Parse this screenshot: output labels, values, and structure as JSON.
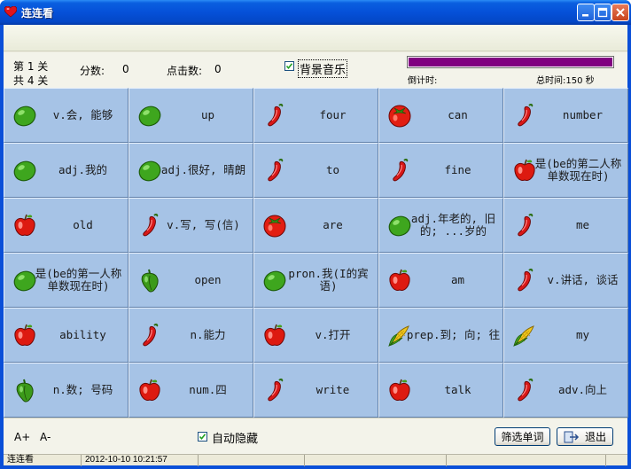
{
  "window": {
    "title": "连连看"
  },
  "info": {
    "level_label": "第 1 关",
    "total_levels_label": "共 4 关",
    "score_label": "分数:",
    "score_value": "0",
    "clicks_label": "点击数:",
    "clicks_value": "0",
    "music_label": "背景音乐",
    "music_checked": true,
    "countdown_label": "倒计时:",
    "total_time_label": "总时间:150 秒",
    "countdown_progress": 1.0
  },
  "board": {
    "rows": [
      [
        {
          "icon": "lime",
          "text": "v.会, 能够"
        },
        {
          "icon": "lime",
          "text": "up"
        },
        {
          "icon": "chili",
          "text": "four"
        },
        {
          "icon": "tomato",
          "text": "can"
        },
        {
          "icon": "chili",
          "text": "number"
        }
      ],
      [
        {
          "icon": "lime",
          "text": "adj.我的"
        },
        {
          "icon": "lime",
          "text": "adj.很好, 晴朗"
        },
        {
          "icon": "chili",
          "text": "to"
        },
        {
          "icon": "chili",
          "text": "fine"
        },
        {
          "icon": "apple",
          "text": "是(be的第二人称单数现在时)"
        }
      ],
      [
        {
          "icon": "apple",
          "text": "old"
        },
        {
          "icon": "chili",
          "text": "v.写, 写(信)"
        },
        {
          "icon": "tomato",
          "text": "are"
        },
        {
          "icon": "lime",
          "text": "adj.年老的, 旧的; ...岁的"
        },
        {
          "icon": "chili",
          "text": "me"
        }
      ],
      [
        {
          "icon": "lime",
          "text": "是(be的第一人称单数现在时)"
        },
        {
          "icon": "pepper",
          "text": "open"
        },
        {
          "icon": "lime",
          "text": "pron.我(I的宾语)"
        },
        {
          "icon": "apple",
          "text": "am"
        },
        {
          "icon": "chili",
          "text": "v.讲话, 谈话"
        }
      ],
      [
        {
          "icon": "apple",
          "text": "ability"
        },
        {
          "icon": "chili",
          "text": "n.能力"
        },
        {
          "icon": "apple",
          "text": "v.打开"
        },
        {
          "icon": "corn",
          "text": "prep.到; 向; 往"
        },
        {
          "icon": "corn",
          "text": "my"
        }
      ],
      [
        {
          "icon": "pepper",
          "text": "n.数; 号码"
        },
        {
          "icon": "apple",
          "text": "num.四"
        },
        {
          "icon": "chili",
          "text": "write"
        },
        {
          "icon": "apple",
          "text": "talk"
        },
        {
          "icon": "chili",
          "text": "adv.向上"
        }
      ]
    ]
  },
  "bottom": {
    "font_increase_label": "A+",
    "font_decrease_label": "A-",
    "autohide_label": "自动隐藏",
    "autohide_checked": true,
    "filter_button_label": "筛选单词",
    "exit_button_label": "退出"
  },
  "statusbar": {
    "app_name": "连连看",
    "datetime": "2012-10-10 10:21:57"
  },
  "colors": {
    "title_bar": "#0550d8",
    "cell_bg": "#a6c3e6",
    "progress_fill": "#800080"
  }
}
